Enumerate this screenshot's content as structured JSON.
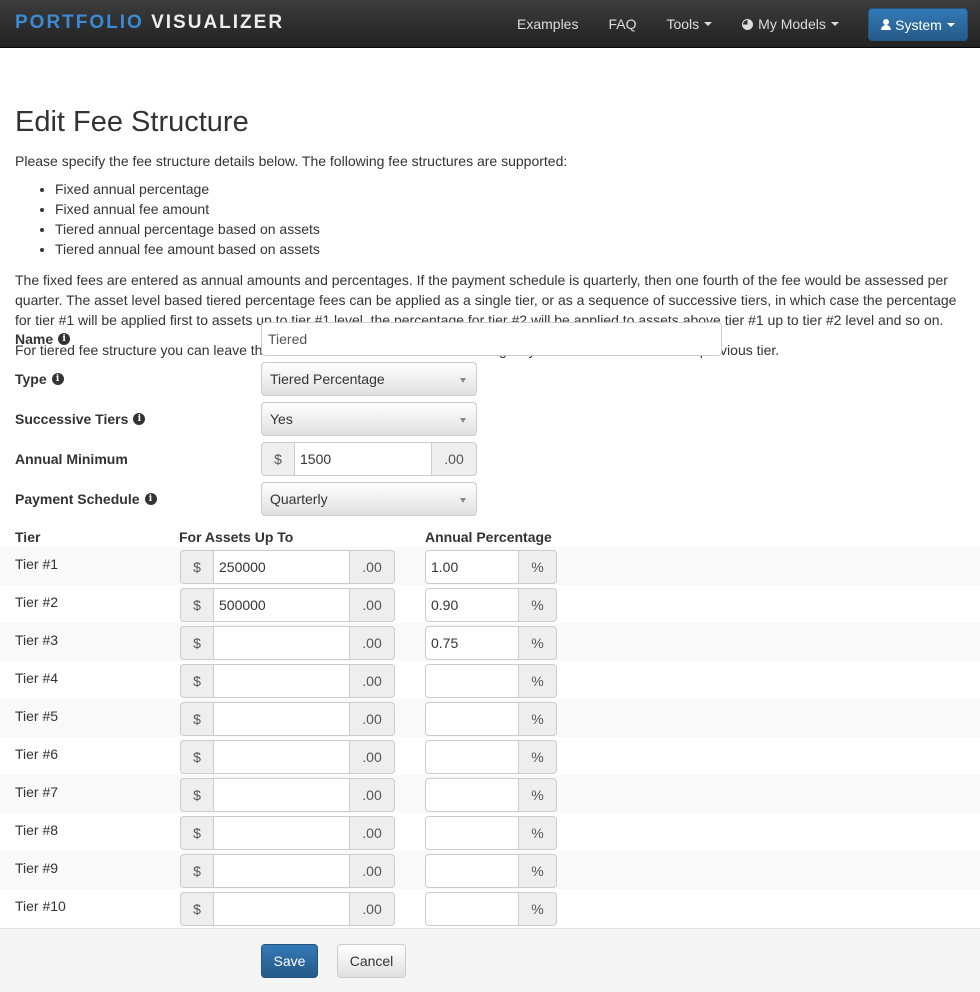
{
  "navbar": {
    "brand_part1": "PORTFOLIO",
    "brand_part2": "VISUALIZER",
    "examples": "Examples",
    "faq": "FAQ",
    "tools": "Tools",
    "my_models": "My Models",
    "system": "System"
  },
  "page": {
    "title": "Edit Fee Structure",
    "intro": "Please specify the fee structure details below. The following fee structures are supported:",
    "types": [
      "Fixed annual percentage",
      "Fixed annual fee amount",
      "Tiered annual percentage based on assets",
      "Tiered annual fee amount based on assets"
    ],
    "para2": "The fixed fees are entered as annual amounts and percentages. If the payment schedule is quarterly, then one fourth of the fee would be assessed per quarter. The asset level based tiered percentage fees can be applied as a single tier, or as a sequence of successive tiers, in which case the percentage for tier #1 will be applied first to assets up to tier #1 level, the percentage for tier #2 will be applied to assets above tier #1 up to tier #2 level and so on.",
    "para3": "For tiered fee structure you can leave the asset level blank on the last tier to signifify all asset levels above the previous tier."
  },
  "form": {
    "name_label": "Name",
    "name_value": "Tiered",
    "type_label": "Type",
    "type_value": "Tiered Percentage",
    "successive_label": "Successive Tiers",
    "successive_value": "Yes",
    "minimum_label": "Annual Minimum",
    "minimum_value": "1500",
    "schedule_label": "Payment Schedule",
    "schedule_value": "Quarterly",
    "currency_symbol": "$",
    "cents_suffix": ".00",
    "percent_suffix": "%"
  },
  "table": {
    "headers": {
      "tier": "Tier",
      "assets": "For Assets Up To",
      "percentage": "Annual Percentage"
    },
    "rows": [
      {
        "name": "Tier #1",
        "assets": "250000",
        "pct": "1.00"
      },
      {
        "name": "Tier #2",
        "assets": "500000",
        "pct": "0.90"
      },
      {
        "name": "Tier #3",
        "assets": "",
        "pct": "0.75"
      },
      {
        "name": "Tier #4",
        "assets": "",
        "pct": ""
      },
      {
        "name": "Tier #5",
        "assets": "",
        "pct": ""
      },
      {
        "name": "Tier #6",
        "assets": "",
        "pct": ""
      },
      {
        "name": "Tier #7",
        "assets": "",
        "pct": ""
      },
      {
        "name": "Tier #8",
        "assets": "",
        "pct": ""
      },
      {
        "name": "Tier #9",
        "assets": "",
        "pct": ""
      },
      {
        "name": "Tier #10",
        "assets": "",
        "pct": ""
      }
    ]
  },
  "actions": {
    "save": "Save",
    "cancel": "Cancel"
  }
}
